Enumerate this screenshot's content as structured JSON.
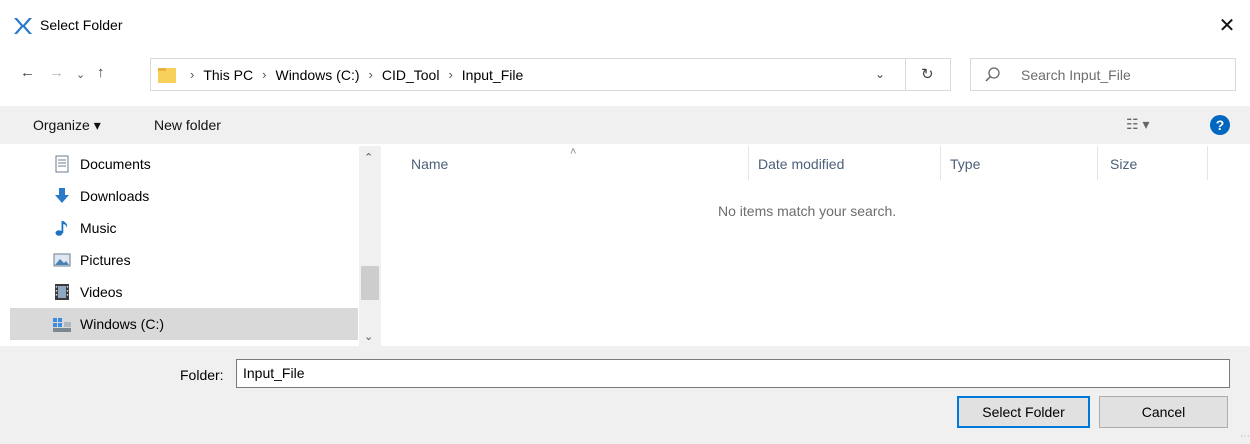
{
  "window": {
    "title": "Select Folder",
    "close_glyph": "✕"
  },
  "nav": {
    "back": "←",
    "forward": "→",
    "recent": "⌄",
    "up": "↑"
  },
  "address": {
    "crumbs": [
      "This PC",
      "Windows (C:)",
      "CID_Tool",
      "Input_File"
    ],
    "separator": "›",
    "dropdown_glyph": "⌄",
    "refresh_glyph": "↻"
  },
  "search": {
    "placeholder": "Search Input_File"
  },
  "toolbar": {
    "organize": "Organize ▾",
    "new_folder": "New folder",
    "view_glyph": "☷ ▾",
    "help_glyph": "?"
  },
  "sidebar": {
    "items": [
      {
        "label": "Documents",
        "icon": "documents-icon"
      },
      {
        "label": "Downloads",
        "icon": "downloads-icon"
      },
      {
        "label": "Music",
        "icon": "music-icon"
      },
      {
        "label": "Pictures",
        "icon": "pictures-icon"
      },
      {
        "label": "Videos",
        "icon": "videos-icon"
      },
      {
        "label": "Windows (C:)",
        "icon": "drive-icon",
        "selected": true
      }
    ]
  },
  "filelist": {
    "columns": [
      "Name",
      "Date modified",
      "Type",
      "Size"
    ],
    "sort_glyph": "˄",
    "empty_message": "No items match your search."
  },
  "footer": {
    "folder_label": "Folder:",
    "folder_value": "Input_File",
    "select_button": "Select Folder",
    "cancel_button": "Cancel"
  },
  "colors": {
    "accent": "#0078d7",
    "help": "#0067c0",
    "selected": "#d9d9d9",
    "column_header": "#4c607a"
  }
}
